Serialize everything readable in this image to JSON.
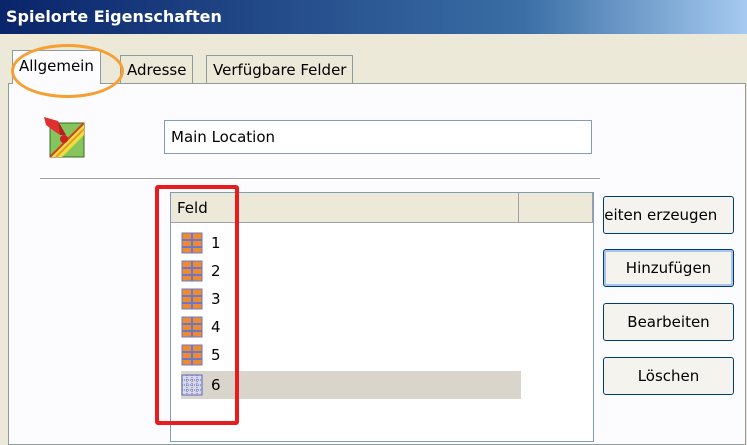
{
  "window": {
    "title": "Spielorte Eigenschaften"
  },
  "tabs": [
    {
      "label": "Allgemein",
      "active": true
    },
    {
      "label": "Adresse",
      "active": false
    },
    {
      "label": "Verfügbare Felder",
      "active": false
    }
  ],
  "general": {
    "location_icon": "location-map-icon",
    "name_value": "Main Location"
  },
  "fields_list": {
    "column_header": "Feld",
    "rows": [
      {
        "label": "1",
        "icon": "field-grid-icon"
      },
      {
        "label": "2",
        "icon": "field-grid-icon"
      },
      {
        "label": "3",
        "icon": "field-grid-icon"
      },
      {
        "label": "4",
        "icon": "field-grid-icon"
      },
      {
        "label": "5",
        "icon": "field-grid-icon"
      },
      {
        "label": "6",
        "icon": "field-grid-dotted-icon",
        "selected": true
      }
    ]
  },
  "buttons": {
    "generate_times": "Zeiten erzeugen",
    "add": "Hinzufügen",
    "edit": "Bearbeiten",
    "delete": "Löschen"
  },
  "colors": {
    "dialog_bg": "#ece9d8",
    "title_bar": "#0a246a",
    "highlight_ellipse": "#f5a032",
    "highlight_rect": "#e81c1c",
    "selection": "#d9d5cc"
  }
}
